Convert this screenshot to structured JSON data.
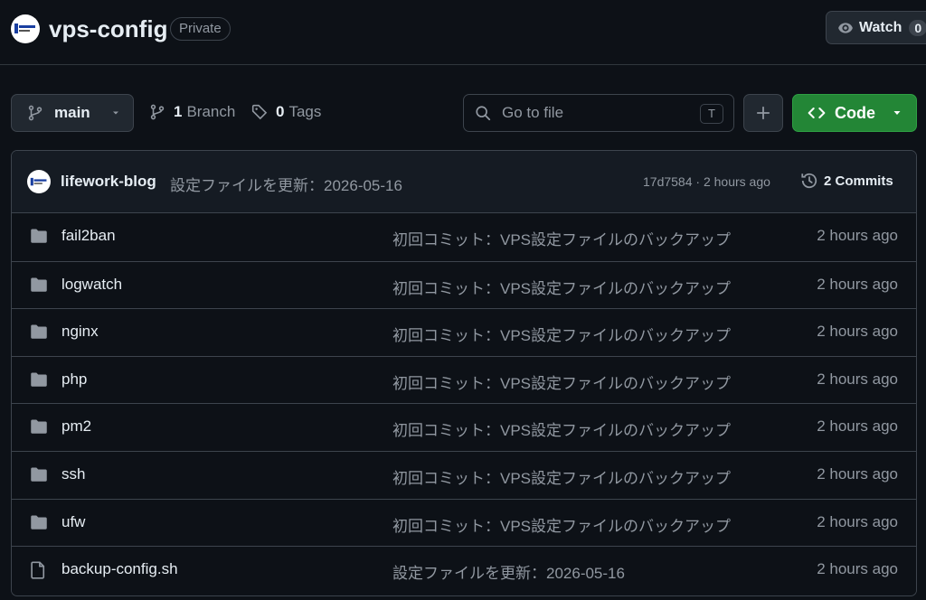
{
  "header": {
    "repo_name": "vps-config",
    "visibility_badge": "Private",
    "watch_label": "Watch",
    "watch_count": "0"
  },
  "toolbar": {
    "branch_name": "main",
    "branch_count": "1",
    "branch_label": "Branch",
    "tag_count": "0",
    "tag_label": "Tags",
    "search_placeholder": "Go to file",
    "search_shortcut": "T",
    "code_label": "Code"
  },
  "latest_commit": {
    "author": "lifework-blog",
    "message": "設定ファイルを更新：2026-05-16",
    "meta": "17d7584 · 2 hours ago",
    "commits_label": "2 Commits"
  },
  "files": [
    {
      "type": "folder",
      "icon": "folder-icon",
      "name": "fail2ban",
      "message": "初回コミット：VPS設定ファイルのバックアップ",
      "time": "2 hours ago"
    },
    {
      "type": "folder",
      "icon": "folder-icon",
      "name": "logwatch",
      "message": "初回コミット：VPS設定ファイルのバックアップ",
      "time": "2 hours ago"
    },
    {
      "type": "folder",
      "icon": "folder-icon",
      "name": "nginx",
      "message": "初回コミット：VPS設定ファイルのバックアップ",
      "time": "2 hours ago"
    },
    {
      "type": "folder",
      "icon": "folder-icon",
      "name": "php",
      "message": "初回コミット：VPS設定ファイルのバックアップ",
      "time": "2 hours ago"
    },
    {
      "type": "folder",
      "icon": "folder-icon",
      "name": "pm2",
      "message": "初回コミット：VPS設定ファイルのバックアップ",
      "time": "2 hours ago"
    },
    {
      "type": "folder",
      "icon": "folder-icon",
      "name": "ssh",
      "message": "初回コミット：VPS設定ファイルのバックアップ",
      "time": "2 hours ago"
    },
    {
      "type": "folder",
      "icon": "folder-icon",
      "name": "ufw",
      "message": "初回コミット：VPS設定ファイルのバックアップ",
      "time": "2 hours ago"
    },
    {
      "type": "file",
      "icon": "file-icon",
      "name": "backup-config.sh",
      "message": "設定ファイルを更新：2026-05-16",
      "time": "2 hours ago"
    }
  ],
  "colors": {
    "background": "#0d1117",
    "code_button": "#238636",
    "muted_text": "#9198a1",
    "border": "#3d444d"
  }
}
